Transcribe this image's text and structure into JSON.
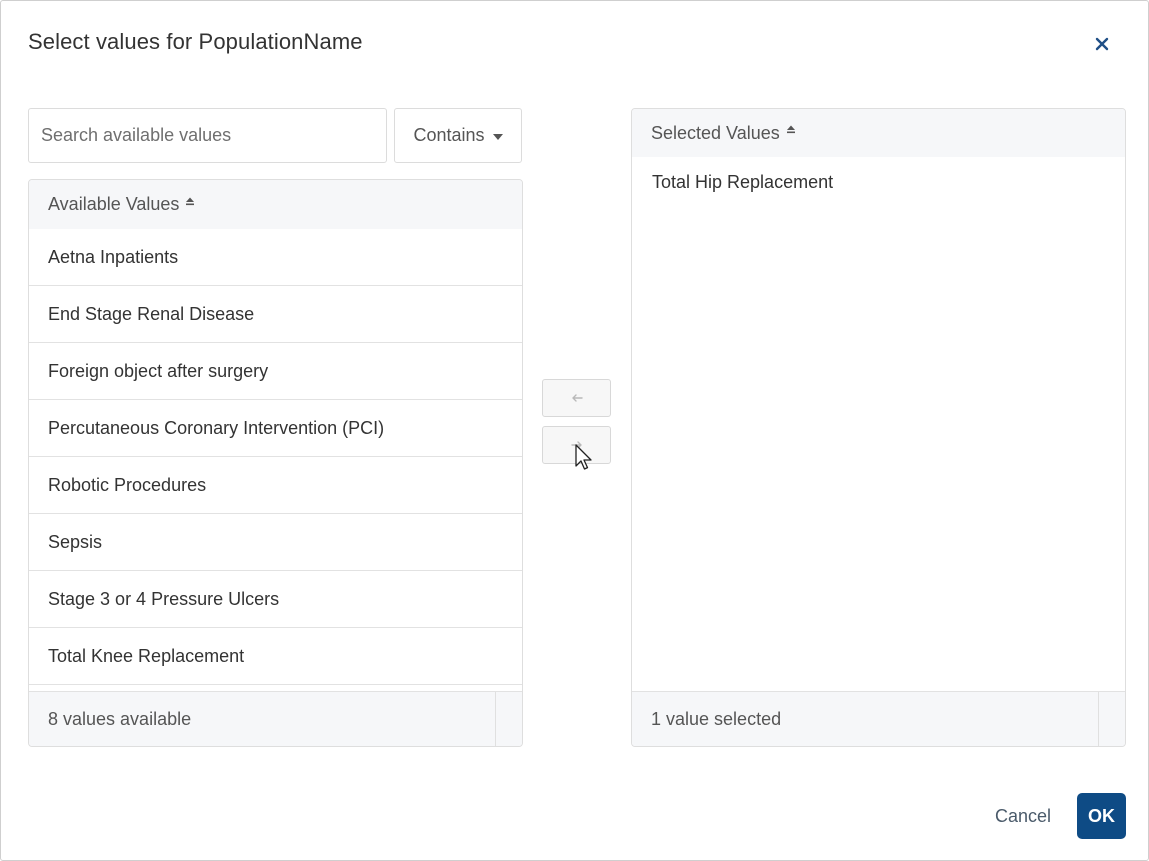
{
  "dialog": {
    "title": "Select values for PopulationName",
    "close_icon": "close-icon"
  },
  "search": {
    "placeholder": "Search available values",
    "value": "",
    "match_mode": "Contains"
  },
  "available": {
    "header": "Available Values",
    "sort_icon": "sort-up-icon",
    "items": [
      "Aetna Inpatients",
      "End Stage Renal Disease",
      "Foreign object after surgery",
      "Percutaneous Coronary Intervention (PCI)",
      "Robotic Procedures",
      "Sepsis",
      "Stage 3 or 4 Pressure Ulcers",
      "Total Knee Replacement"
    ],
    "footer": "8 values available"
  },
  "selected": {
    "header": "Selected Values",
    "sort_icon": "sort-up-icon",
    "items": [
      "Total Hip Replacement"
    ],
    "footer": "1 value selected"
  },
  "transfer": {
    "move_left_icon": "arrow-left-icon",
    "move_right_icon": "arrow-right-icon"
  },
  "actions": {
    "cancel_label": "Cancel",
    "ok_label": "OK"
  },
  "colors": {
    "primary": "#0e4b85",
    "header_bg": "#f6f7f9",
    "border": "#dedede"
  }
}
